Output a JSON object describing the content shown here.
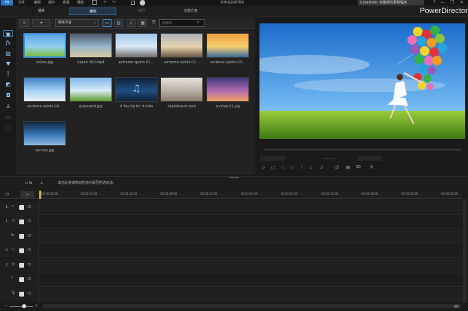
{
  "menu": [
    "文件",
    "编辑",
    "插件",
    "查看",
    "播放"
  ],
  "project_title": "未命名的新项目",
  "notice": "CyberLink: 有最新的更新程序",
  "window": {
    "help": "?",
    "minimize": "—",
    "restore": "❐",
    "close": "✕"
  },
  "modes": {
    "capture": "捕获",
    "edit": "编辑",
    "produce": "制作",
    "disc": "创建光盘"
  },
  "brand": "PowerDirector",
  "library": {
    "filter": "媒体内容",
    "search_placeholder": "搜索库",
    "items": [
      {
        "name": "ballon.jpg",
        "colors": [
          "#5ea6e6",
          "#8fd0f0",
          "#7cbf3a"
        ]
      },
      {
        "name": "beach 360.mp4",
        "colors": [
          "#4c5a6a",
          "#96b7cc",
          "#d7c79b"
        ]
      },
      {
        "name": "extreme sports 01...",
        "colors": [
          "#9fc6ea",
          "#d9e8f5",
          "#6f6f6f"
        ]
      },
      {
        "name": "extreme sports 02...",
        "colors": [
          "#a9b1b8",
          "#e8d2b0",
          "#6a5a44"
        ]
      },
      {
        "name": "extreme sports 03...",
        "colors": [
          "#f0a040",
          "#f8d070",
          "#3a6aa0"
        ]
      },
      {
        "name": "extreme sports 04...",
        "colors": [
          "#3e7fc4",
          "#a4d0f4",
          "#e8f0f8"
        ]
      },
      {
        "name": "grassland.jpg",
        "colors": [
          "#7db6ea",
          "#d8ecf8",
          "#5c9b2a"
        ]
      },
      {
        "name": "R You Up for It.m4a",
        "colors": [
          "#0f2238",
          "#1f4f80",
          "#0f2238"
        ]
      },
      {
        "name": "Skateboard.mp4",
        "colors": [
          "#e6e2dc",
          "#b8b0a6",
          "#8a7a6a"
        ]
      },
      {
        "name": "sunrise 01.jpg",
        "colors": [
          "#3a3a7a",
          "#b06ab0",
          "#f0a060"
        ]
      },
      {
        "name": "sunrise.jpg",
        "colors": [
          "#0e2240",
          "#3a78b8",
          "#8ab8e0"
        ]
      }
    ]
  },
  "preview": {
    "timecode": "--:--:--:--",
    "mode_3d": "3D"
  },
  "timeline": {
    "hint": "单击此处或拖动所选片段至所选轨道。",
    "ruler": [
      "00:00:00:00",
      "00:00:24:00",
      "00:01:12:00",
      "00:01:49:00",
      "00:02:24:00",
      "00:03:00:00",
      "00:03:35:00",
      "00:04:12:00",
      "00:04:48:00",
      "00:05:24:00",
      "00:06:00:00"
    ],
    "tracks": [
      {
        "label": "1.",
        "icon": "▭"
      },
      {
        "label": "1.",
        "icon": "◁)"
      },
      {
        "label": "",
        "icon": "fx"
      },
      {
        "label": "2.",
        "icon": "▭"
      },
      {
        "label": "2.",
        "icon": "◁)"
      },
      {
        "label": "",
        "icon": "T"
      },
      {
        "label": "",
        "icon": "🎙"
      }
    ]
  }
}
